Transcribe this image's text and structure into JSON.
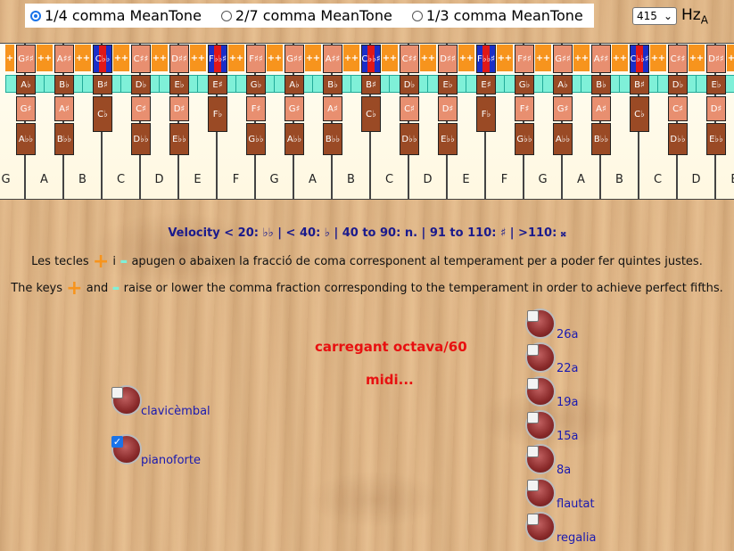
{
  "temperament": {
    "options": [
      "1/4 comma MeanTone",
      "2/7 comma MeanTone",
      "1/3 comma MeanTone"
    ],
    "selected_index": 0
  },
  "pitch": {
    "value": "415",
    "unit": "Hz",
    "unit_sub": "A"
  },
  "white_keys": [
    "G",
    "A",
    "B",
    "C",
    "D",
    "E",
    "F",
    "G",
    "A",
    "B",
    "C",
    "D",
    "E",
    "F",
    "G",
    "A",
    "B",
    "C",
    "D",
    "E"
  ],
  "black_keys": [
    {
      "top": "G♯♯",
      "mid": "A♭",
      "bot1": "G♯",
      "bot2": "A♭♭"
    },
    {
      "top": "A♯♯",
      "mid": "B♭",
      "bot1": "A♯",
      "bot2": "B♭♭"
    },
    {
      "top": "C♭♭",
      "mid": "B♯",
      "bot1": "C♭",
      "bot2": "",
      "blue": true
    },
    {
      "top": "C♯♯",
      "mid": "D♭",
      "bot1": "C♯",
      "bot2": "D♭♭"
    },
    {
      "top": "D♯♯",
      "mid": "E♭",
      "bot1": "D♯",
      "bot2": "E♭♭"
    },
    {
      "top": "F♭♭♯",
      "mid": "E♯",
      "bot1": "F♭",
      "bot2": "",
      "blue": true
    },
    {
      "top": "F♯♯",
      "mid": "G♭",
      "bot1": "F♯",
      "bot2": "G♭♭"
    },
    {
      "top": "G♯♯",
      "mid": "A♭",
      "bot1": "G♯",
      "bot2": "A♭♭"
    },
    {
      "top": "A♯♯",
      "mid": "B♭",
      "bot1": "A♯",
      "bot2": "B♭♭"
    },
    {
      "top": "C♭♭♯",
      "mid": "B♯",
      "bot1": "C♭",
      "bot2": "",
      "blue": true
    },
    {
      "top": "C♯♯",
      "mid": "D♭",
      "bot1": "C♯",
      "bot2": "D♭♭"
    },
    {
      "top": "D♯♯",
      "mid": "E♭",
      "bot1": "D♯",
      "bot2": "E♭♭"
    },
    {
      "top": "F♭♭♯",
      "mid": "E♯",
      "bot1": "F♭",
      "bot2": "",
      "blue": true
    },
    {
      "top": "F♯♯",
      "mid": "G♭",
      "bot1": "F♯",
      "bot2": "G♭♭"
    },
    {
      "top": "G♯♯",
      "mid": "A♭",
      "bot1": "G♯",
      "bot2": "A♭♭"
    },
    {
      "top": "A♯♯",
      "mid": "B♭",
      "bot1": "A♯",
      "bot2": "B♭♭"
    },
    {
      "top": "C♭♭♯",
      "mid": "B♯",
      "bot1": "C♭",
      "bot2": "",
      "blue": true
    },
    {
      "top": "C♯♯",
      "mid": "D♭",
      "bot1": "C♯",
      "bot2": "D♭♭"
    },
    {
      "top": "D♯♯",
      "mid": "E♭",
      "bot1": "D♯",
      "bot2": "E♭♭"
    }
  ],
  "plus_label": "+",
  "velocity_text": "Velocity < 20: ♭♭ | < 40: ♭ | 40 to 90: n. | 91 to 110: ♯ | >110: 𝄪",
  "ca": {
    "pre": "Les tecles",
    "mid": "i",
    "post": "apugen o abaixen la fracció de coma corresponent al temperament per a poder fer quintes justes."
  },
  "en": {
    "pre": "The keys",
    "mid": "and",
    "post": "raise or lower the comma fraction corresponding to the temperament in order to achieve perfect fifths."
  },
  "status": {
    "loading": "carregant octava/60",
    "midi": "midi..."
  },
  "instruments": [
    {
      "label": "clavicèmbal",
      "checked": false
    },
    {
      "label": "pianoforte",
      "checked": true
    }
  ],
  "stops": [
    {
      "label": "26a",
      "checked": false
    },
    {
      "label": "22a",
      "checked": false
    },
    {
      "label": "19a",
      "checked": false
    },
    {
      "label": "15a",
      "checked": false
    },
    {
      "label": "8a",
      "checked": false
    },
    {
      "label": "flautat",
      "checked": false
    },
    {
      "label": "regalia",
      "checked": false
    }
  ]
}
